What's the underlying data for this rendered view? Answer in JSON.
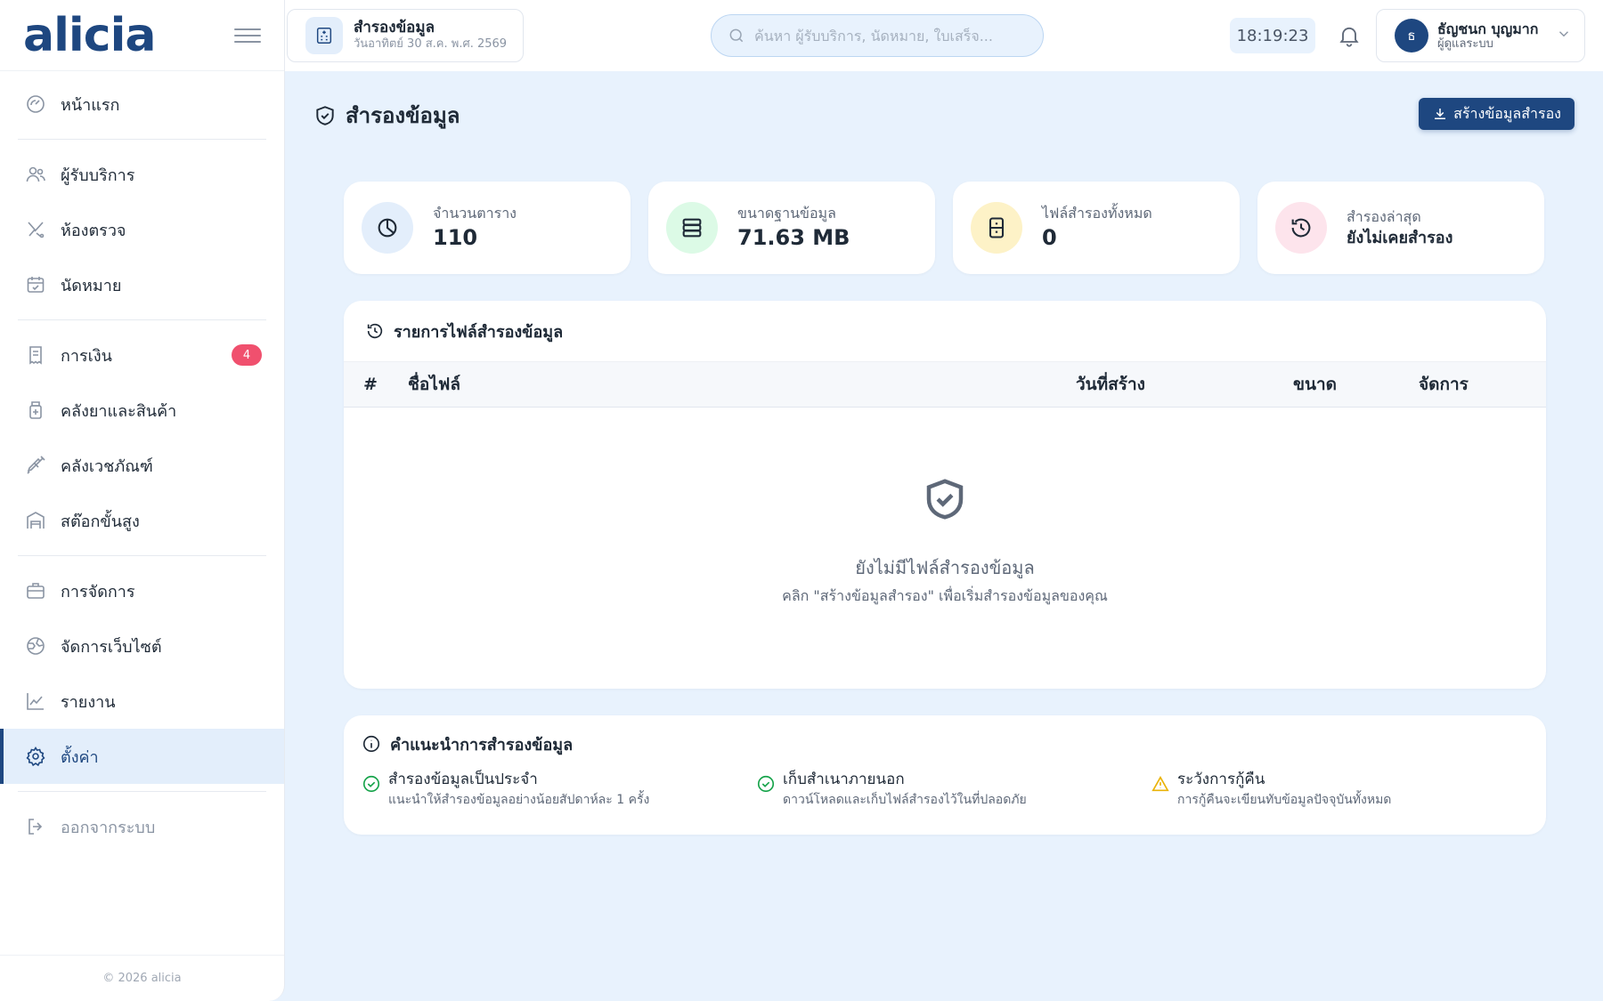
{
  "brand": {
    "logo": "alicia"
  },
  "sidebar": {
    "items": [
      {
        "label": "หน้าแรก",
        "icon": "dashboard-icon"
      },
      {
        "label": "ผู้รับบริการ",
        "icon": "users-icon"
      },
      {
        "label": "ห้องตรวจ",
        "icon": "stethoscope-icon"
      },
      {
        "label": "นัดหมาย",
        "icon": "calendar-check-icon"
      },
      {
        "label": "การเงิน",
        "icon": "receipt-icon",
        "badge": "4"
      },
      {
        "label": "คลังยาและสินค้า",
        "icon": "medicine-bottle-icon"
      },
      {
        "label": "คลังเวชภัณฑ์",
        "icon": "syringe-icon"
      },
      {
        "label": "สต๊อกขั้นสูง",
        "icon": "warehouse-icon"
      },
      {
        "label": "การจัดการ",
        "icon": "briefcase-icon"
      },
      {
        "label": "จัดการเว็บไซต์",
        "icon": "globe-icon"
      },
      {
        "label": "รายงาน",
        "icon": "chart-line-icon"
      },
      {
        "label": "ตั้งค่า",
        "icon": "gear-icon"
      },
      {
        "label": "ออกจากระบบ",
        "icon": "logout-icon"
      }
    ],
    "copyright": "© 2026 alicia"
  },
  "topbar": {
    "page_chip": {
      "title": "สำรองข้อมูล",
      "subtitle": "วันอาทิตย์ 30 ส.ค. พ.ศ. 2569",
      "icon": "hospital-icon"
    },
    "search": {
      "placeholder": "ค้นหา ผู้รับบริการ, นัดหมาย, ใบเสร็จ...",
      "value": ""
    },
    "clock": "18:19:23",
    "user": {
      "initial": "ธ",
      "name": "ธัญชนก บุญมาก",
      "role": "ผู้ดูแลระบบ"
    }
  },
  "page": {
    "title": "สำรองข้อมูล",
    "create_button": "สร้างข้อมูลสำรอง"
  },
  "stats": [
    {
      "label": "จำนวนตาราง",
      "value": "110",
      "icon": "pie-chart-icon",
      "color": "#e3eefb"
    },
    {
      "label": "ขนาดฐานข้อมูล",
      "value": "71.63 MB",
      "icon": "server-icon",
      "color": "#dcfae6"
    },
    {
      "label": "ไฟล์สำรองทั้งหมด",
      "value": "0",
      "icon": "archive-icon",
      "color": "#fdf2c7"
    },
    {
      "label": "สำรองล่าสุด",
      "value": "ยังไม่เคยสำรอง",
      "icon": "history-icon",
      "color": "#fde4ec"
    }
  ],
  "backup_list": {
    "title": "รายการไฟล์สำรองข้อมูล",
    "columns": [
      "#",
      "ชื่อไฟล์",
      "วันที่สร้าง",
      "ขนาด",
      "จัดการ"
    ],
    "empty_title": "ยังไม่มีไฟล์สำรองข้อมูล",
    "empty_desc": "คลิก \"สร้างข้อมูลสำรอง\" เพื่อเริ่มสำรองข้อมูลของคุณ"
  },
  "tips": {
    "title": "คำแนะนำการสำรองข้อมูล",
    "items": [
      {
        "title": "สำรองข้อมูลเป็นประจำ",
        "desc": "แนะนำให้สำรองข้อมูลอย่างน้อยสัปดาห์ละ 1 ครั้ง",
        "icon": "check-circle-icon",
        "color": "#16a34a"
      },
      {
        "title": "เก็บสำเนาภายนอก",
        "desc": "ดาวน์โหลดและเก็บไฟล์สำรองไว้ในที่ปลอดภัย",
        "icon": "check-circle-icon",
        "color": "#16a34a"
      },
      {
        "title": "ระวังการกู้คืน",
        "desc": "การกู้คืนจะเขียนทับข้อมูลปัจจุบันทั้งหมด",
        "icon": "warning-icon",
        "color": "#eab308"
      }
    ]
  }
}
